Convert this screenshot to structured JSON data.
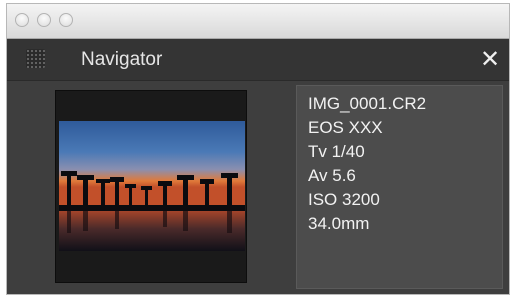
{
  "window": {
    "title_buttons": [
      "close-traffic-icon",
      "minimize-traffic-icon",
      "zoom-traffic-icon"
    ]
  },
  "panel": {
    "title": "Navigator",
    "close_label": "✕",
    "grip_icon": "grip-dots-icon"
  },
  "info": {
    "filename": "IMG_0001.CR2",
    "camera": "EOS XXX",
    "shutter": "Tv 1/40",
    "aperture": "Av 5.6",
    "iso": "ISO 3200",
    "focal_length": "34.0mm"
  },
  "colors": {
    "panel_bg": "#3e3e3e",
    "info_bg": "#4c4c4c",
    "text": "#f2f2f2"
  }
}
